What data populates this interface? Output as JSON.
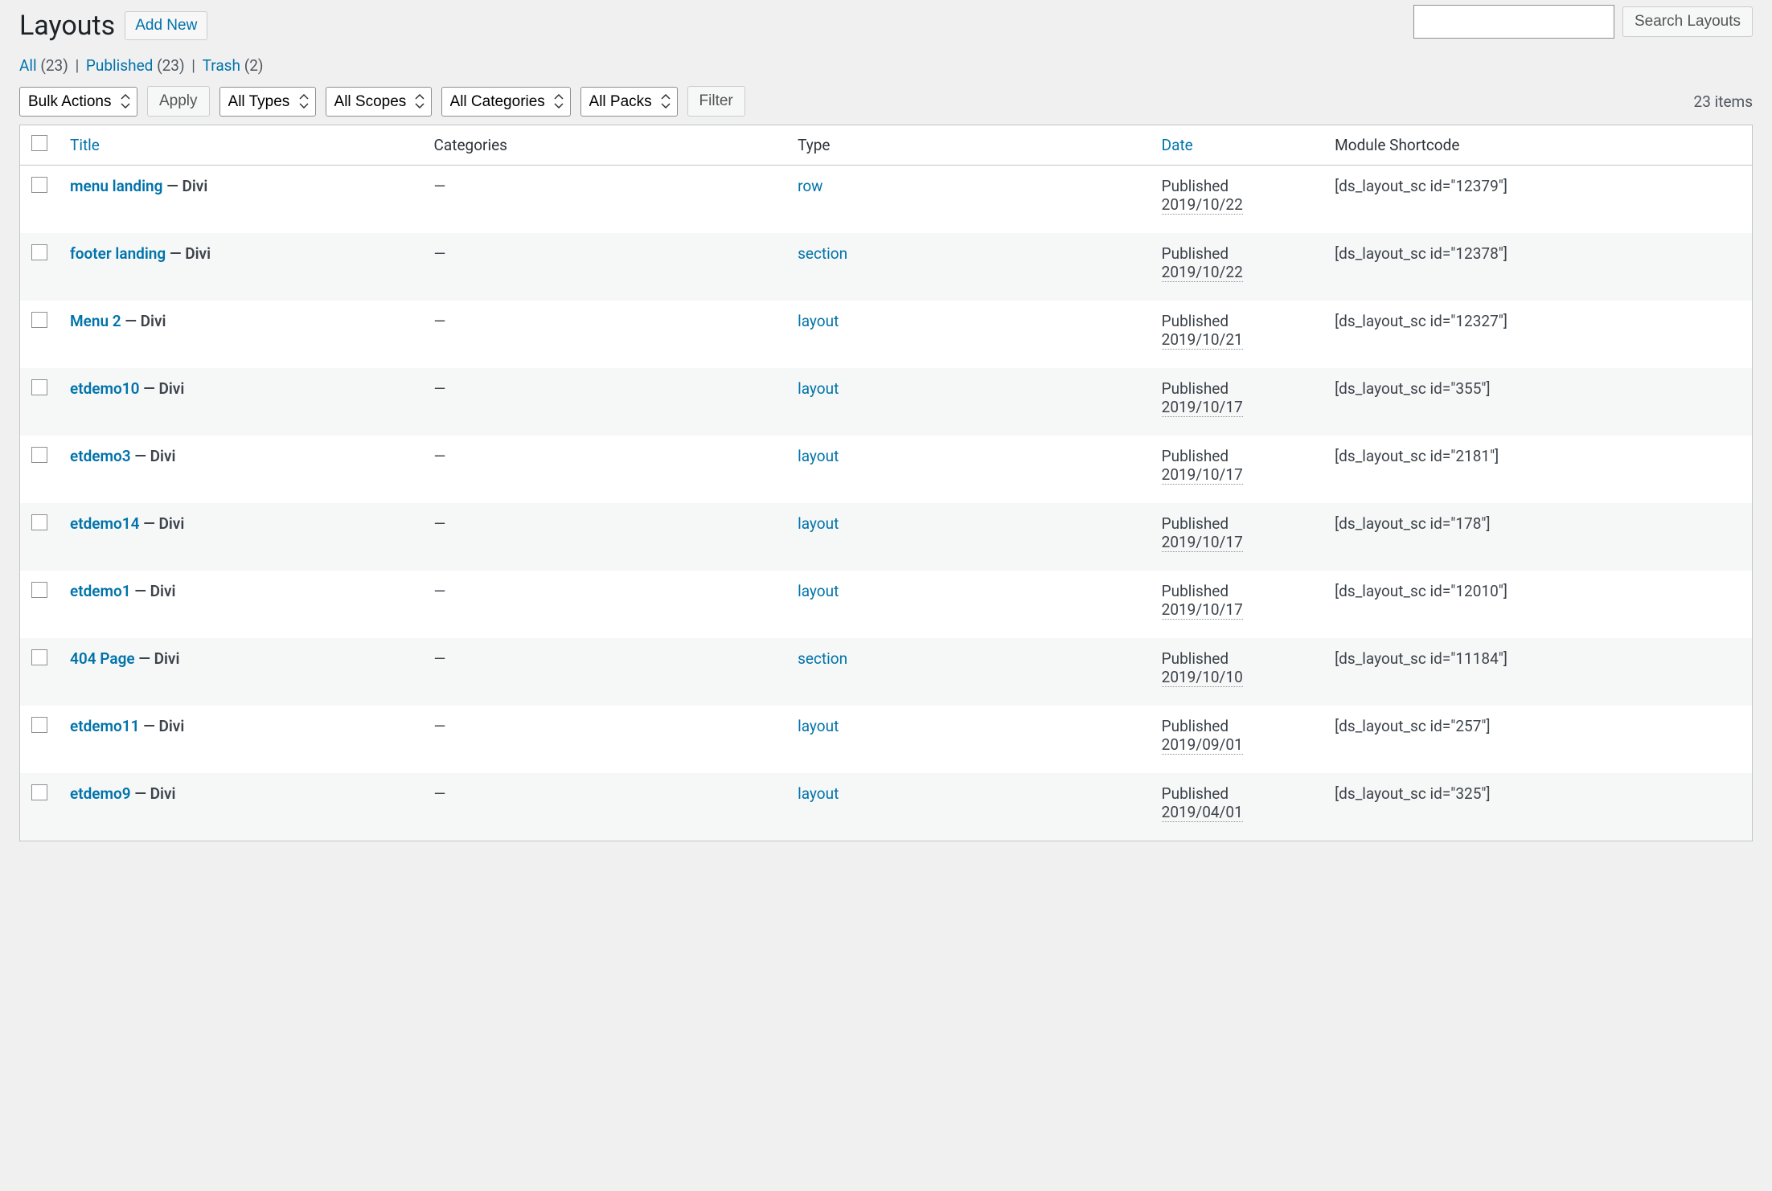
{
  "page": {
    "title": "Layouts",
    "add_new": "Add New"
  },
  "filters": {
    "all": {
      "label": "All",
      "count": "(23)"
    },
    "published": {
      "label": "Published",
      "count": "(23)"
    },
    "trash": {
      "label": "Trash",
      "count": "(2)"
    }
  },
  "search": {
    "button": "Search Layouts"
  },
  "bulk": {
    "bulk_actions": "Bulk Actions",
    "apply": "Apply",
    "all_types": "All Types",
    "all_scopes": "All Scopes",
    "all_categories": "All Categories",
    "all_packs": "All Packs",
    "filter": "Filter",
    "item_count": "23 items"
  },
  "columns": {
    "title": "Title",
    "categories": "Categories",
    "type": "Type",
    "date": "Date",
    "shortcode": "Module Shortcode"
  },
  "rows": [
    {
      "title": "menu landing",
      "suffix": " — Divi",
      "categories": "—",
      "type": "row",
      "status": "Published",
      "date": "2019/10/22",
      "shortcode": "[ds_layout_sc id=\"12379\"]"
    },
    {
      "title": "footer landing",
      "suffix": " — Divi",
      "categories": "—",
      "type": "section",
      "status": "Published",
      "date": "2019/10/22",
      "shortcode": "[ds_layout_sc id=\"12378\"]"
    },
    {
      "title": "Menu 2",
      "suffix": " — Divi",
      "categories": "—",
      "type": "layout",
      "status": "Published",
      "date": "2019/10/21",
      "shortcode": "[ds_layout_sc id=\"12327\"]"
    },
    {
      "title": "etdemo10",
      "suffix": " — Divi",
      "categories": "—",
      "type": "layout",
      "status": "Published",
      "date": "2019/10/17",
      "shortcode": "[ds_layout_sc id=\"355\"]"
    },
    {
      "title": "etdemo3",
      "suffix": " — Divi",
      "categories": "—",
      "type": "layout",
      "status": "Published",
      "date": "2019/10/17",
      "shortcode": "[ds_layout_sc id=\"2181\"]"
    },
    {
      "title": "etdemo14",
      "suffix": " — Divi",
      "categories": "—",
      "type": "layout",
      "status": "Published",
      "date": "2019/10/17",
      "shortcode": "[ds_layout_sc id=\"178\"]"
    },
    {
      "title": "etdemo1",
      "suffix": " — Divi",
      "categories": "—",
      "type": "layout",
      "status": "Published",
      "date": "2019/10/17",
      "shortcode": "[ds_layout_sc id=\"12010\"]"
    },
    {
      "title": "404 Page",
      "suffix": " — Divi",
      "categories": "—",
      "type": "section",
      "status": "Published",
      "date": "2019/10/10",
      "shortcode": "[ds_layout_sc id=\"11184\"]"
    },
    {
      "title": "etdemo11",
      "suffix": " — Divi",
      "categories": "—",
      "type": "layout",
      "status": "Published",
      "date": "2019/09/01",
      "shortcode": "[ds_layout_sc id=\"257\"]"
    },
    {
      "title": "etdemo9",
      "suffix": " — Divi",
      "categories": "—",
      "type": "layout",
      "status": "Published",
      "date": "2019/04/01",
      "shortcode": "[ds_layout_sc id=\"325\"]"
    }
  ]
}
